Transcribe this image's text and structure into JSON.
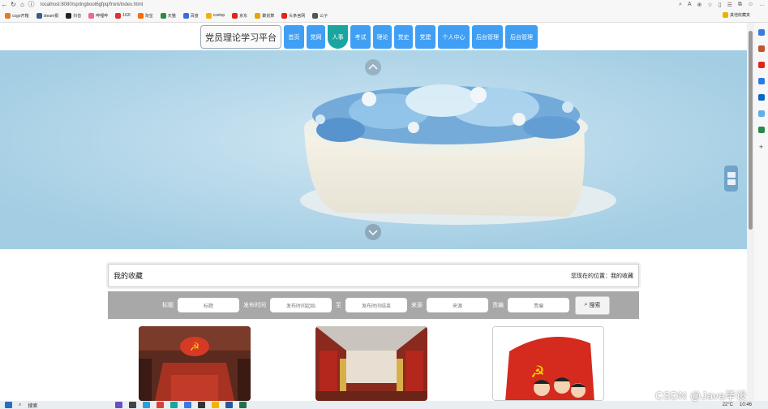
{
  "browser": {
    "url": "localhost:8080/springboot6gfpq/front/index.html",
    "nav_icons": [
      "back-icon",
      "refresh-icon",
      "home-icon",
      "info-icon"
    ],
    "right_icons": [
      "read-aloud-icon",
      "text-size-icon",
      "zoom-icon",
      "favorite-icon",
      "split-icon",
      "favorites-list-icon",
      "collections-icon",
      "profile-icon",
      "more-icon"
    ],
    "bookmarks": [
      {
        "label": "csgo开箱",
        "color": "#e07b2a"
      },
      {
        "label": "steam报",
        "color": "#3a5e8c"
      },
      {
        "label": "抖音",
        "color": "#222222"
      },
      {
        "label": "哔哩哔",
        "color": "#e86a92"
      },
      {
        "label": "163l",
        "color": "#d33"
      },
      {
        "label": "淘宝",
        "color": "#ff6a00"
      },
      {
        "label": "天猫",
        "color": "#2a8a4a"
      },
      {
        "label": "百度",
        "color": "#3c6be0"
      },
      {
        "label": "csstop",
        "color": "#f0b400"
      },
      {
        "label": "京东",
        "color": "#e1251b"
      },
      {
        "label": "聚划算",
        "color": "#e8a400"
      },
      {
        "label": "头条官网",
        "color": "#e1251b"
      },
      {
        "label": "公子",
        "color": "#555555"
      }
    ],
    "fav_folder": "其他收藏夹"
  },
  "nav": {
    "brand": "党员理论学习平台",
    "items": [
      {
        "label": "首页",
        "active": false
      },
      {
        "label": "党网",
        "active": false
      },
      {
        "label": "人事",
        "active": true
      },
      {
        "label": "考试",
        "active": false
      },
      {
        "label": "理论",
        "active": false
      },
      {
        "label": "党史",
        "active": false
      },
      {
        "label": "党建",
        "active": false
      },
      {
        "label": "个人中心",
        "active": false
      },
      {
        "label": "后台管理",
        "active": false
      },
      {
        "label": "后台管理",
        "active": false
      }
    ]
  },
  "panel": {
    "title": "我的收藏",
    "breadcrumb": "您现在的位置：我的收藏"
  },
  "search": {
    "title_label": "标题",
    "title_placeholder": "标题",
    "date_label": "发布时间",
    "date_start_placeholder": "发布时间起始",
    "to_label": "至",
    "date_end_placeholder": "发布时间结束",
    "source_label": "来源",
    "source_placeholder": "来源",
    "editor_label": "责编",
    "editor_placeholder": "责编",
    "button_label": "搜索"
  },
  "taskbar": {
    "search_label": "搜索",
    "weather": "22°C",
    "time": "10:46"
  },
  "watermark": "CSDN @Java毕设",
  "colors": {
    "nav_blue": "#3f9ff5",
    "nav_active": "#1aa6a0",
    "search_bg": "#a8a8a8"
  }
}
